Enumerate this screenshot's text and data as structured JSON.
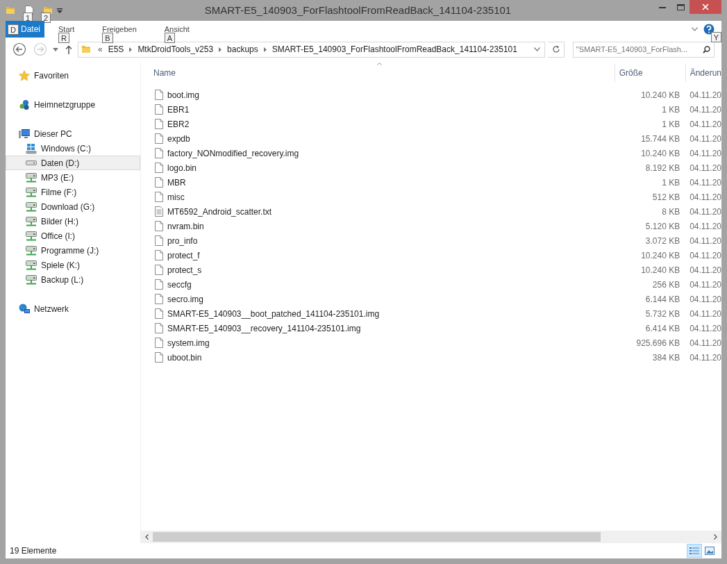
{
  "window": {
    "title": "SMART-E5_140903_ForFlashtoolFromReadBack_141104-235101"
  },
  "quick_access_keytips": [
    "1",
    "2"
  ],
  "ribbon": {
    "tabs": [
      {
        "label": "Datei",
        "keytip": "D",
        "kind": "file"
      },
      {
        "label": "Start",
        "keytip": "R",
        "kind": "tab"
      },
      {
        "label": "Freigeben",
        "keytip": "B",
        "kind": "tab"
      },
      {
        "label": "Ansicht",
        "keytip": "A",
        "kind": "tab"
      }
    ],
    "help_keytip": "Y"
  },
  "address_bar": {
    "overflow": "«",
    "crumbs": [
      "E5S",
      "MtkDroidTools_v253",
      "backups",
      "SMART-E5_140903_ForFlashtoolFromReadBack_141104-235101"
    ]
  },
  "search": {
    "placeholder": "\"SMART-E5_140903_ForFlash..."
  },
  "sidebar": {
    "items": [
      {
        "label": "Favoriten",
        "kind": "favorites",
        "selected": false
      },
      {
        "label": "Heimnetzgruppe",
        "kind": "homegroup",
        "selected": false
      },
      {
        "label": "Dieser PC",
        "kind": "pc",
        "selected": false,
        "children": [
          {
            "label": "Windows (C:)",
            "kind": "system",
            "selected": false
          },
          {
            "label": "Daten (D:)",
            "kind": "drive",
            "selected": true
          },
          {
            "label": "MP3 (E:)",
            "kind": "netdrive",
            "selected": false
          },
          {
            "label": "Filme (F:)",
            "kind": "netdrive",
            "selected": false
          },
          {
            "label": "Download (G:)",
            "kind": "netdrive",
            "selected": false
          },
          {
            "label": "Bilder (H:)",
            "kind": "netdrive",
            "selected": false
          },
          {
            "label": "Office (I:)",
            "kind": "netdrive",
            "selected": false
          },
          {
            "label": "Programme (J:)",
            "kind": "netdrive",
            "selected": false
          },
          {
            "label": "Spiele (K:)",
            "kind": "netdrive",
            "selected": false
          },
          {
            "label": "Backup (L:)",
            "kind": "netdrive",
            "selected": false
          }
        ]
      },
      {
        "label": "Netzwerk",
        "kind": "network",
        "selected": false
      }
    ]
  },
  "table": {
    "columns": [
      "Name",
      "Größe",
      "Änderun"
    ],
    "rows": [
      {
        "kind": "file",
        "name": "boot.img",
        "size": "10.240 KB",
        "date": "04.11.20"
      },
      {
        "kind": "file",
        "name": "EBR1",
        "size": "1 KB",
        "date": "04.11.20"
      },
      {
        "kind": "file",
        "name": "EBR2",
        "size": "1 KB",
        "date": "04.11.20"
      },
      {
        "kind": "file",
        "name": "expdb",
        "size": "15.744 KB",
        "date": "04.11.20"
      },
      {
        "kind": "file",
        "name": "factory_NONmodified_recovery.img",
        "size": "10.240 KB",
        "date": "04.11.20"
      },
      {
        "kind": "file",
        "name": "logo.bin",
        "size": "8.192 KB",
        "date": "04.11.20"
      },
      {
        "kind": "file",
        "name": "MBR",
        "size": "1 KB",
        "date": "04.11.20"
      },
      {
        "kind": "file",
        "name": "misc",
        "size": "512 KB",
        "date": "04.11.20"
      },
      {
        "kind": "text",
        "name": "MT6592_Android_scatter.txt",
        "size": "8 KB",
        "date": "04.11.20"
      },
      {
        "kind": "file",
        "name": "nvram.bin",
        "size": "5.120 KB",
        "date": "04.11.20"
      },
      {
        "kind": "file",
        "name": "pro_info",
        "size": "3.072 KB",
        "date": "04.11.20"
      },
      {
        "kind": "file",
        "name": "protect_f",
        "size": "10.240 KB",
        "date": "04.11.20"
      },
      {
        "kind": "file",
        "name": "protect_s",
        "size": "10.240 KB",
        "date": "04.11.20"
      },
      {
        "kind": "file",
        "name": "seccfg",
        "size": "256 KB",
        "date": "04.11.20"
      },
      {
        "kind": "file",
        "name": "secro.img",
        "size": "6.144 KB",
        "date": "04.11.20"
      },
      {
        "kind": "file",
        "name": "SMART-E5_140903__boot_patched_141104-235101.img",
        "size": "5.732 KB",
        "date": "04.11.20"
      },
      {
        "kind": "file",
        "name": "SMART-E5_140903__recovery_141104-235101.img",
        "size": "6.414 KB",
        "date": "04.11.20"
      },
      {
        "kind": "file",
        "name": "system.img",
        "size": "925.696 KB",
        "date": "04.11.20"
      },
      {
        "kind": "file",
        "name": "uboot.bin",
        "size": "384 KB",
        "date": "04.11.20"
      }
    ]
  },
  "status_bar": {
    "count": "19 Elemente",
    "view_buttons": [
      {
        "kind": "details",
        "selected": true
      },
      {
        "kind": "large_icons",
        "selected": false
      }
    ]
  }
}
